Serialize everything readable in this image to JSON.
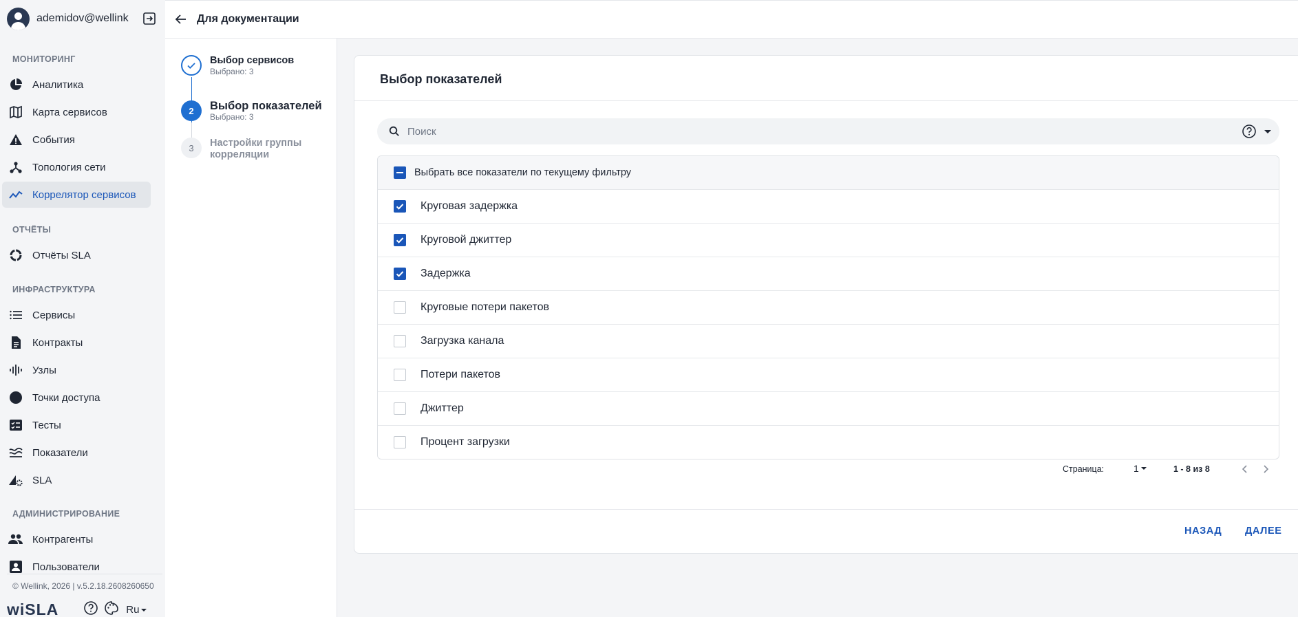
{
  "user": {
    "name": "ademidov@wellink..."
  },
  "sidebar": {
    "sections": [
      {
        "title": "МОНИТОРИНГ",
        "items": [
          {
            "label": "Аналитика",
            "icon": "pie-chart-icon"
          },
          {
            "label": "Карта сервисов",
            "icon": "map-icon"
          },
          {
            "label": "События",
            "icon": "warning-icon"
          },
          {
            "label": "Топология сети",
            "icon": "topology-icon"
          },
          {
            "label": "Коррелятор сервисов",
            "icon": "trend-icon",
            "active": true
          }
        ]
      },
      {
        "title": "ОТЧЁТЫ",
        "items": [
          {
            "label": "Отчёты SLA",
            "icon": "donut-icon"
          }
        ]
      },
      {
        "title": "ИНФРАСТРУКТУРА",
        "items": [
          {
            "label": "Сервисы",
            "icon": "list-icon"
          },
          {
            "label": "Контракты",
            "icon": "document-icon"
          },
          {
            "label": "Узлы",
            "icon": "signal-bars-icon"
          },
          {
            "label": "Точки доступа",
            "icon": "circle-icon"
          },
          {
            "label": "Тесты",
            "icon": "checklist-icon"
          },
          {
            "label": "Показатели",
            "icon": "waves-icon"
          },
          {
            "label": "SLA",
            "icon": "sla-gear-icon"
          }
        ]
      },
      {
        "title": "АДМИНИСТРИРОВАНИЕ",
        "items": [
          {
            "label": "Контрагенты",
            "icon": "people-icon"
          },
          {
            "label": "Пользователи",
            "icon": "user-badge-icon"
          }
        ]
      }
    ],
    "copyright": "© Wellink, 2026 | v.5.2.18.2608260650",
    "brand": "wiSLA",
    "language": "Ru"
  },
  "header": {
    "title": "Для документации"
  },
  "stepper": {
    "steps": [
      {
        "number": "1",
        "title": "Выбор сервисов",
        "subtitle": "Выбрано: 3",
        "state": "done"
      },
      {
        "number": "2",
        "title": "Выбор показателей",
        "subtitle": "Выбрано: 3",
        "state": "current"
      },
      {
        "number": "3",
        "title": "Настройки группы корреляции",
        "subtitle": "",
        "state": "pending"
      }
    ]
  },
  "main": {
    "title": "Выбор показателей",
    "search_placeholder": "Поиск",
    "select_all_label": "Выбрать все показатели по текущему фильтру",
    "metrics": [
      {
        "label": "Круговая задержка",
        "checked": true
      },
      {
        "label": "Круговой джиттер",
        "checked": true
      },
      {
        "label": "Задержка",
        "checked": true
      },
      {
        "label": "Круговые потери пакетов",
        "checked": false
      },
      {
        "label": "Загрузка канала",
        "checked": false
      },
      {
        "label": "Потери пакетов",
        "checked": false
      },
      {
        "label": "Джиттер",
        "checked": false
      },
      {
        "label": "Процент загрузки",
        "checked": false
      }
    ],
    "pagination": {
      "label": "Страница:",
      "page": "1",
      "range": "1 - 8 из 8"
    },
    "buttons": {
      "back": "НАЗАД",
      "next": "ДАЛЕЕ"
    }
  },
  "colors": {
    "accent": "#1a56b8",
    "step_active": "#1f6fd1",
    "sidebar_bg": "#f4f5f7"
  }
}
